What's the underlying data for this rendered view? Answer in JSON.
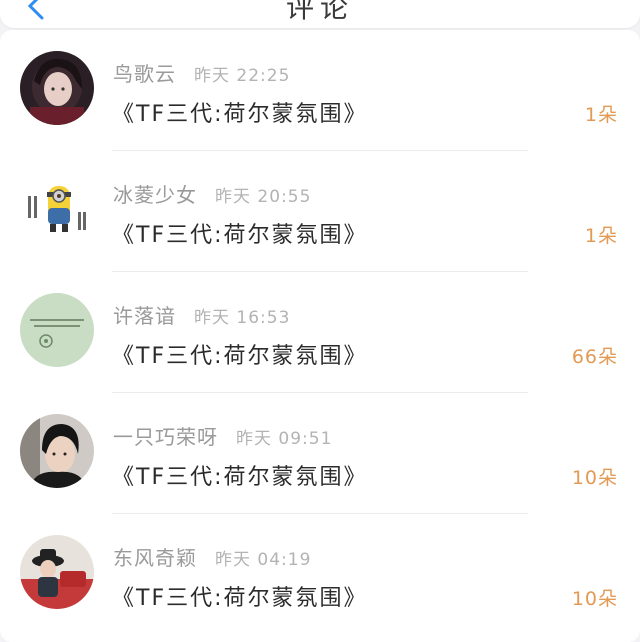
{
  "header": {
    "title": "评论"
  },
  "colors": {
    "accent": "#e29a54",
    "name": "#9a9a9a",
    "time": "#b3b3b3",
    "message": "#2b2b2b",
    "back": "#2f8cf0"
  },
  "comments": [
    {
      "name": "鸟歌云",
      "time": "昨天 22:25",
      "message": "《TF三代:荷尔蒙氛围》",
      "count": "1朵"
    },
    {
      "name": "冰菱少女",
      "time": "昨天 20:55",
      "message": "《TF三代:荷尔蒙氛围》",
      "count": "1朵"
    },
    {
      "name": "许落谙",
      "time": "昨天 16:53",
      "message": "《TF三代:荷尔蒙氛围》",
      "count": "66朵"
    },
    {
      "name": "一只巧荣呀",
      "time": "昨天 09:51",
      "message": "《TF三代:荷尔蒙氛围》",
      "count": "10朵"
    },
    {
      "name": "东风奇颖",
      "time": "昨天 04:19",
      "message": "《TF三代:荷尔蒙氛围》",
      "count": "10朵"
    }
  ]
}
